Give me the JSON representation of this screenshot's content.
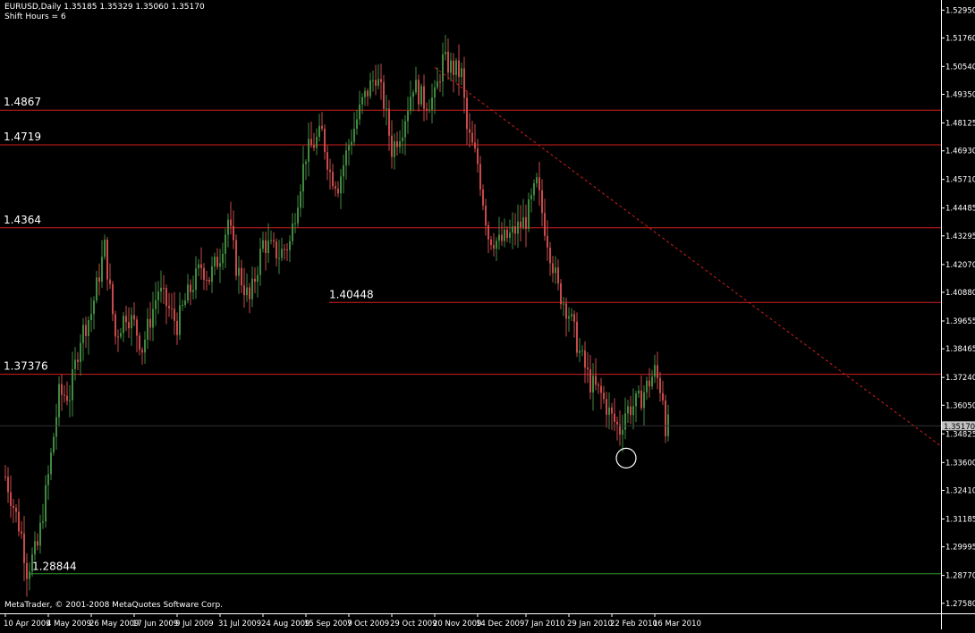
{
  "header": {
    "symbol_line": "EURUSD,Daily  1.35185 1.35329 1.35060 1.35170",
    "shift_line": "Shift Hours = 6"
  },
  "footer": {
    "copyright": "MetaTrader, © 2001-2008 MetaQuotes Software Corp."
  },
  "colors": {
    "background": "#000000",
    "up_candle": "#3f8a3f",
    "down_candle": "#c84a4a",
    "level_line": "#d21e1e",
    "support_line": "#2e9a2e",
    "trend_line": "#d21e1e",
    "axis_text": "#ffffff",
    "price_label_bg": "#c0c0c0"
  },
  "chart_data": {
    "type": "candlestick",
    "symbol": "EURUSD",
    "timeframe": "Daily",
    "ylim": [
      1.2715,
      1.5323
    ],
    "y_ticks": [
      "1.52950",
      "1.51760",
      "1.50540",
      "1.49350",
      "1.48125",
      "1.46930",
      "1.45710",
      "1.44485",
      "1.43295",
      "1.42070",
      "1.40880",
      "1.39655",
      "1.38465",
      "1.37240",
      "1.36050",
      "1.34825",
      "1.33600",
      "1.32410",
      "1.31185",
      "1.29995",
      "1.28770",
      "1.27580"
    ],
    "x_ticks": [
      "10 Apr 2009",
      "4 May 2009",
      "26 May 2009",
      "17 Jun 2009",
      "9 Jul 2009",
      "31 Jul 2009",
      "24 Aug 2009",
      "15 Sep 2009",
      "7 Oct 2009",
      "29 Oct 2009",
      "20 Nov 2009",
      "14 Dec 2009",
      "7 Jan 2010",
      "29 Jan 2010",
      "22 Feb 2010",
      "16 Mar 2010"
    ],
    "current_price": "1.35170",
    "horizontal_levels": [
      {
        "label": "1.4867",
        "value": 1.4867
      },
      {
        "label": "1.4719",
        "value": 1.4719
      },
      {
        "label": "1.4364",
        "value": 1.4364
      },
      {
        "label": "1.40448",
        "value": 1.40448
      },
      {
        "label": "1.37376",
        "value": 1.37376
      }
    ],
    "support_level": {
      "label": "1.28844",
      "value": 1.28844
    },
    "trend_line": {
      "from": [
        "20 Nov 2009",
        1.505
      ],
      "to": [
        "end",
        1.343
      ]
    },
    "marker_circle": {
      "date": "22 Feb 2010",
      "price": 1.344
    },
    "anchors": [
      [
        "10 Apr 2009",
        1.33
      ],
      [
        "20 Apr 2009",
        1.305
      ],
      [
        "22 Apr 2009",
        1.29
      ],
      [
        "28 Apr 2009",
        1.3
      ],
      [
        "4 May 2009",
        1.33
      ],
      [
        "8 May 2009",
        1.365
      ],
      [
        "14 May 2009",
        1.365
      ],
      [
        "20 May 2009",
        1.39
      ],
      [
        "26 May 2009",
        1.4
      ],
      [
        "2 Jun 2009",
        1.428
      ],
      [
        "8 Jun 2009",
        1.39
      ],
      [
        "12 Jun 2009",
        1.4
      ],
      [
        "17 Jun 2009",
        1.395
      ],
      [
        "22 Jun 2009",
        1.385
      ],
      [
        "30 Jun 2009",
        1.41
      ],
      [
        "9 Jul 2009",
        1.395
      ],
      [
        "14 Jul 2009",
        1.405
      ],
      [
        "22 Jul 2009",
        1.42
      ],
      [
        "27 Jul 2009",
        1.415
      ],
      [
        "31 Jul 2009",
        1.425
      ],
      [
        "5 Aug 2009",
        1.44
      ],
      [
        "10 Aug 2009",
        1.42
      ],
      [
        "17 Aug 2009",
        1.405
      ],
      [
        "24 Aug 2009",
        1.43
      ],
      [
        "1 Sep 2009",
        1.425
      ],
      [
        "7 Sep 2009",
        1.43
      ],
      [
        "10 Sep 2009",
        1.45
      ],
      [
        "15 Sep 2009",
        1.468
      ],
      [
        "23 Sep 2009",
        1.477
      ],
      [
        "28 Sep 2009",
        1.46
      ],
      [
        "1 Oct 2009",
        1.455
      ],
      [
        "7 Oct 2009",
        1.472
      ],
      [
        "14 Oct 2009",
        1.49
      ],
      [
        "21 Oct 2009",
        1.502
      ],
      [
        "26 Oct 2009",
        1.49
      ],
      [
        "29 Oct 2009",
        1.47
      ],
      [
        "4 Nov 2009",
        1.48
      ],
      [
        "10 Nov 2009",
        1.498
      ],
      [
        "16 Nov 2009",
        1.49
      ],
      [
        "20 Nov 2009",
        1.492
      ],
      [
        "25 Nov 2009",
        1.508
      ],
      [
        "30 Nov 2009",
        1.505
      ],
      [
        "4 Dec 2009",
        1.502
      ],
      [
        "8 Dec 2009",
        1.478
      ],
      [
        "14 Dec 2009",
        1.464
      ],
      [
        "20 Dec 2009",
        1.433
      ],
      [
        "24 Dec 2009",
        1.43
      ],
      [
        "30 Dec 2009",
        1.433
      ],
      [
        "7 Jan 2010",
        1.44
      ],
      [
        "13 Jan 2010",
        1.455
      ],
      [
        "18 Jan 2010",
        1.437
      ],
      [
        "25 Jan 2010",
        1.41
      ],
      [
        "29 Jan 2010",
        1.4
      ],
      [
        "4 Feb 2010",
        1.383
      ],
      [
        "10 Feb 2010",
        1.37
      ],
      [
        "16 Feb 2010",
        1.365
      ],
      [
        "22 Feb 2010",
        1.355
      ],
      [
        "25 Feb 2010",
        1.35
      ],
      [
        "1 Mar 2010",
        1.358
      ],
      [
        "8 Mar 2010",
        1.362
      ],
      [
        "16 Mar 2010",
        1.375
      ],
      [
        "19 Mar 2010",
        1.365
      ],
      [
        "22 Mar 2010",
        1.352
      ]
    ]
  }
}
